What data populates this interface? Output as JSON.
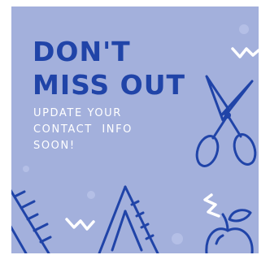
{
  "poster": {
    "headline_line1": "DON'T",
    "headline_line2": "MISS OUT",
    "body_line1": "UPDATE YOUR",
    "body_line2": "CONTACT  INFO",
    "body_line3": "SOON!"
  },
  "colors": {
    "background": "#a3b0dc",
    "headline": "#2044a8",
    "body_text": "#ffffff",
    "illustration": "#2044a8",
    "accent_squiggles": "#ffffff"
  },
  "icons": [
    "scissors-icon",
    "ruler-icon",
    "set-square-icon",
    "apple-icon",
    "zigzag-icon"
  ]
}
